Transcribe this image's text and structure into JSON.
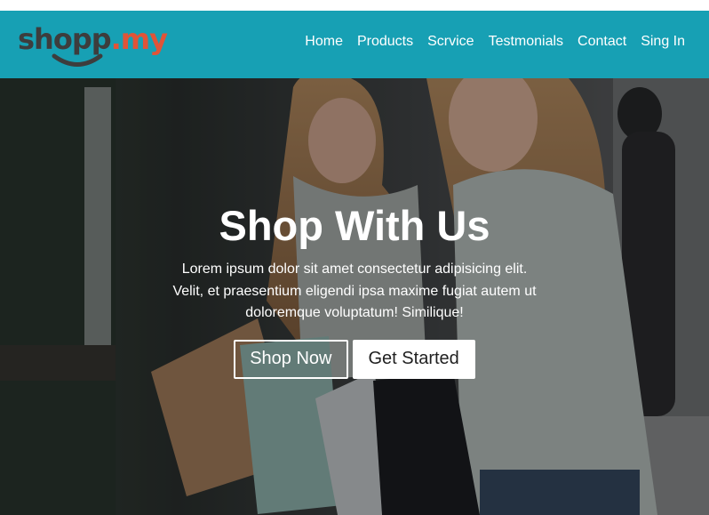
{
  "brand": {
    "logo_main": "shopp",
    "logo_accent": ".my",
    "color_primary": "#17a0b4",
    "color_logo_dark": "#3d3d3d",
    "color_logo_accent": "#e05438"
  },
  "nav": {
    "items": [
      {
        "label": "Home"
      },
      {
        "label": "Products"
      },
      {
        "label": "Scrvice"
      },
      {
        "label": "Testmonials"
      },
      {
        "label": "Contact"
      },
      {
        "label": "Sing In"
      }
    ]
  },
  "hero": {
    "title": "Shop With Us",
    "text": "Lorem ipsum dolor sit amet consectetur adipisicing elit. Velit, et praesentium eligendi ipsa maxime fugiat autem ut doloremque voluptatum! Similique!",
    "primary_button": "Shop Now",
    "secondary_button": "Get Started",
    "background_description_icon": "shopping-women-photo"
  }
}
